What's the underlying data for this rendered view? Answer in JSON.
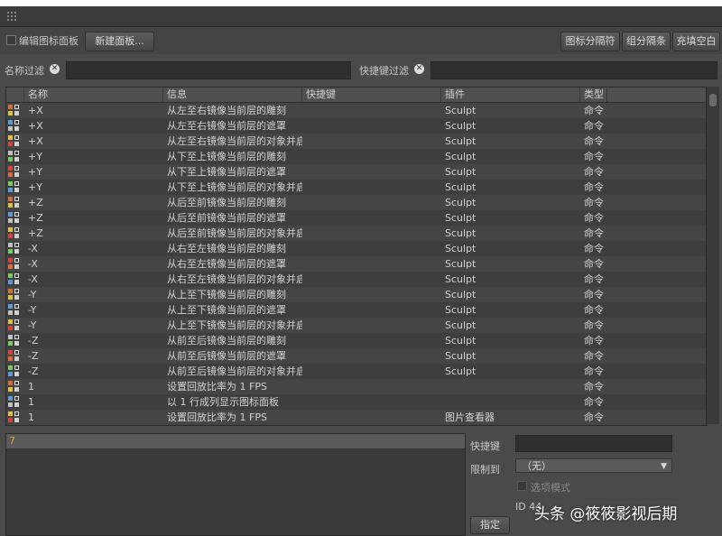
{
  "toolbar": {
    "edit_icon_panel_label": "编辑图标面板",
    "new_panel_button": "新建面板...",
    "icon_separator_button": "图标分隔符",
    "group_separator_button": "组分隔条",
    "fill_blank_button": "充填空白"
  },
  "filters": {
    "name_filter_label": "名称过滤",
    "shortcut_filter_label": "快捷键过滤",
    "name_filter_value": "",
    "shortcut_filter_value": ""
  },
  "table": {
    "columns": [
      "名称",
      "信息",
      "快捷键",
      "插件",
      "类型"
    ],
    "rows": [
      {
        "name": "+X",
        "info": "从左至右镜像当前层的雕刻",
        "shortcut": "",
        "plugin": "Sculpt",
        "type": "命令"
      },
      {
        "name": "+X",
        "info": "从左至右镜像当前层的遮罩",
        "shortcut": "",
        "plugin": "Sculpt",
        "type": "命令"
      },
      {
        "name": "+X",
        "info": "从左至右镜像当前层的对象并启",
        "shortcut": "",
        "plugin": "Sculpt",
        "type": "命令"
      },
      {
        "name": "+Y",
        "info": "从下至上镜像当前层的雕刻",
        "shortcut": "",
        "plugin": "Sculpt",
        "type": "命令"
      },
      {
        "name": "+Y",
        "info": "从下至上镜像当前层的遮罩",
        "shortcut": "",
        "plugin": "Sculpt",
        "type": "命令"
      },
      {
        "name": "+Y",
        "info": "从下至上镜像当前层的对象并启",
        "shortcut": "",
        "plugin": "Sculpt",
        "type": "命令"
      },
      {
        "name": "+Z",
        "info": "从后至前镜像当前层的雕刻",
        "shortcut": "",
        "plugin": "Sculpt",
        "type": "命令"
      },
      {
        "name": "+Z",
        "info": "从后至前镜像当前层的遮罩",
        "shortcut": "",
        "plugin": "Sculpt",
        "type": "命令"
      },
      {
        "name": "+Z",
        "info": "从后至前镜像当前层的对象并启",
        "shortcut": "",
        "plugin": "Sculpt",
        "type": "命令"
      },
      {
        "name": "-X",
        "info": "从右至左镜像当前层的雕刻",
        "shortcut": "",
        "plugin": "Sculpt",
        "type": "命令"
      },
      {
        "name": "-X",
        "info": "从右至左镜像当前层的遮罩",
        "shortcut": "",
        "plugin": "Sculpt",
        "type": "命令"
      },
      {
        "name": "-X",
        "info": "从右至左镜像当前层的对象并启",
        "shortcut": "",
        "plugin": "Sculpt",
        "type": "命令"
      },
      {
        "name": "-Y",
        "info": "从上至下镜像当前层的雕刻",
        "shortcut": "",
        "plugin": "Sculpt",
        "type": "命令"
      },
      {
        "name": "-Y",
        "info": "从上至下镜像当前层的遮罩",
        "shortcut": "",
        "plugin": "Sculpt",
        "type": "命令"
      },
      {
        "name": "-Y",
        "info": "从上至下镜像当前层的对象并启",
        "shortcut": "",
        "plugin": "Sculpt",
        "type": "命令"
      },
      {
        "name": "-Z",
        "info": "从前至后镜像当前层的雕刻",
        "shortcut": "",
        "plugin": "Sculpt",
        "type": "命令"
      },
      {
        "name": "-Z",
        "info": "从前至后镜像当前层的遮罩",
        "shortcut": "",
        "plugin": "Sculpt",
        "type": "命令"
      },
      {
        "name": "-Z",
        "info": "从前至后镜像当前层的对象并启",
        "shortcut": "",
        "plugin": "Sculpt",
        "type": "命令"
      },
      {
        "name": "1",
        "info": "设置回放比率为 1 FPS",
        "shortcut": "",
        "plugin": "",
        "type": "命令"
      },
      {
        "name": "1",
        "info": "以 1 行成列显示图标面板",
        "shortcut": "",
        "plugin": "",
        "type": "命令"
      },
      {
        "name": "1",
        "info": "设置回放比率为 1 FPS",
        "shortcut": "",
        "plugin": "图片查看器",
        "type": "命令"
      }
    ]
  },
  "editor": {
    "input_value": "7",
    "shortcut_label": "快捷键",
    "shortcut_value": "",
    "restrict_label": "限制到",
    "restrict_value": "（无）",
    "option_mode_label": "选项模式",
    "id_label": "ID 44",
    "assign_button": "指定"
  },
  "watermark": "头条 @筱筱影视后期"
}
